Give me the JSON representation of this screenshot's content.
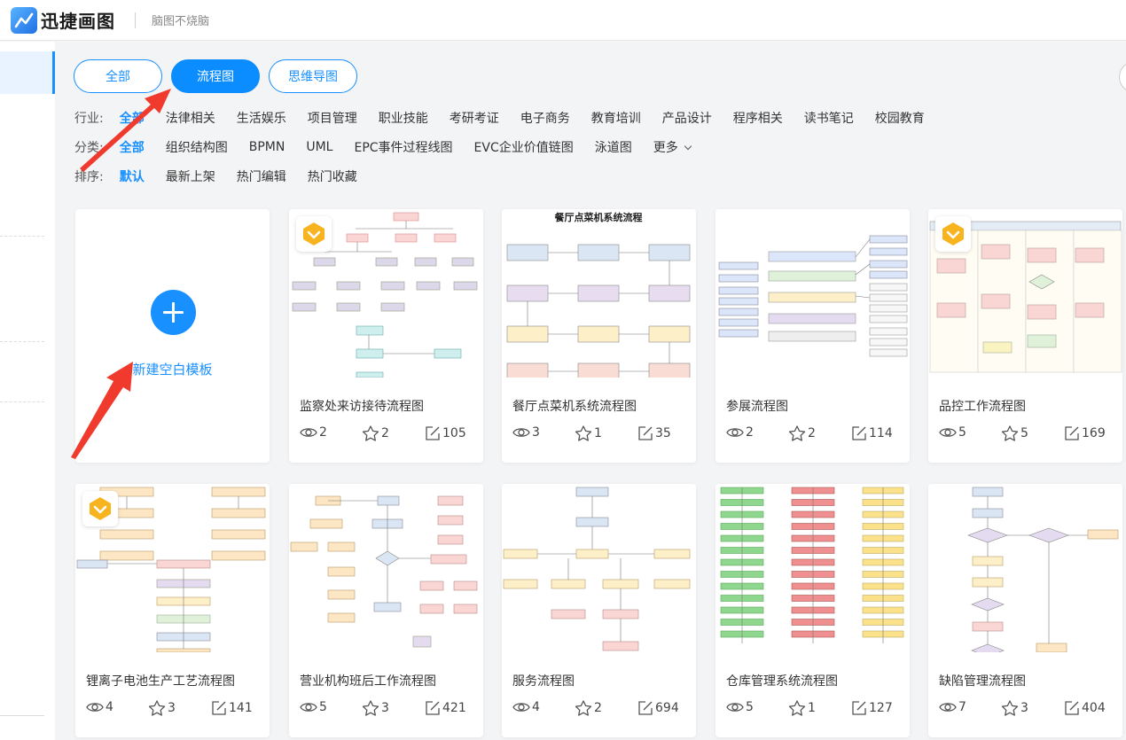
{
  "header": {
    "app_name": "迅捷画图",
    "slogan": "脑图不烧脑"
  },
  "tabs": [
    {
      "label": "全部",
      "active": false
    },
    {
      "label": "流程图",
      "active": true
    },
    {
      "label": "思维导图",
      "active": false
    }
  ],
  "filters": {
    "industry": {
      "label": "行业:",
      "options": [
        "全部",
        "法律相关",
        "生活娱乐",
        "项目管理",
        "职业技能",
        "考研考证",
        "电子商务",
        "教育培训",
        "产品设计",
        "程序相关",
        "读书笔记",
        "校园教育"
      ],
      "active_index": 0
    },
    "category": {
      "label": "分类:",
      "options": [
        "全部",
        "组织结构图",
        "BPMN",
        "UML",
        "EPC事件过程线图",
        "EVC企业价值链图",
        "泳道图"
      ],
      "more_label": "更多",
      "active_index": 0
    },
    "sort": {
      "label": "排序:",
      "options": [
        "默认",
        "最新上架",
        "热门编辑",
        "热门收藏"
      ],
      "active_index": 0
    }
  },
  "new_template": {
    "label": "新建空白模板"
  },
  "cards": [
    {
      "title": "监察处来访接待流程图",
      "views": "2",
      "stars": "2",
      "edits": "105",
      "vip": true
    },
    {
      "title": "餐厅点菜机系统流程图",
      "views": "3",
      "stars": "1",
      "edits": "35",
      "vip": false,
      "thumb_title": "餐厅点菜机系统流程"
    },
    {
      "title": "参展流程图",
      "views": "2",
      "stars": "2",
      "edits": "114",
      "vip": false
    },
    {
      "title": "品控工作流程图",
      "views": "5",
      "stars": "5",
      "edits": "169",
      "vip": true
    },
    {
      "title": "锂离子电池生产工艺流程图",
      "views": "4",
      "stars": "3",
      "edits": "141",
      "vip": true
    },
    {
      "title": "营业机构班后工作流程图",
      "views": "5",
      "stars": "3",
      "edits": "421",
      "vip": false
    },
    {
      "title": "服务流程图",
      "views": "4",
      "stars": "2",
      "edits": "694",
      "vip": false
    },
    {
      "title": "仓库管理系统流程图",
      "views": "5",
      "stars": "1",
      "edits": "127",
      "vip": false
    },
    {
      "title": "缺陷管理流程图",
      "views": "7",
      "stars": "3",
      "edits": "404",
      "vip": false
    }
  ],
  "colors": {
    "accent": "#1890ff",
    "annotation_arrow": "#f03a2e",
    "vip_badge": "#f8b41e"
  }
}
